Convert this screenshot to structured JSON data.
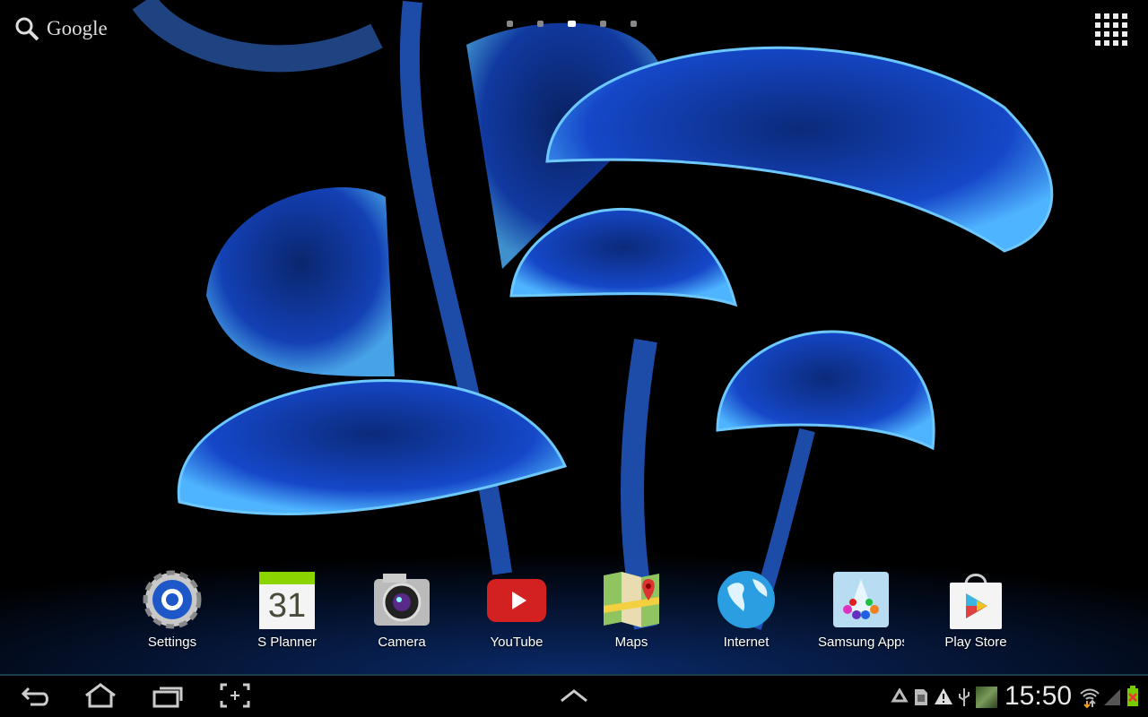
{
  "search": {
    "label": "Google",
    "icon": "search-icon"
  },
  "pages": {
    "count": 5,
    "active": 3
  },
  "dock": [
    {
      "label": "Settings",
      "icon": "settings-icon"
    },
    {
      "label": "S Planner",
      "icon": "calendar-icon",
      "day": "31"
    },
    {
      "label": "Camera",
      "icon": "camera-icon"
    },
    {
      "label": "YouTube",
      "icon": "youtube-icon"
    },
    {
      "label": "Maps",
      "icon": "maps-icon"
    },
    {
      "label": "Internet",
      "icon": "globe-icon"
    },
    {
      "label": "Samsung Apps",
      "icon": "samsung-apps-icon"
    },
    {
      "label": "Play Store",
      "icon": "play-store-icon"
    }
  ],
  "status": {
    "time": "15:50"
  },
  "colors": {
    "accent": "#1c3b4a",
    "wallpaper": "#1a4fd0"
  }
}
